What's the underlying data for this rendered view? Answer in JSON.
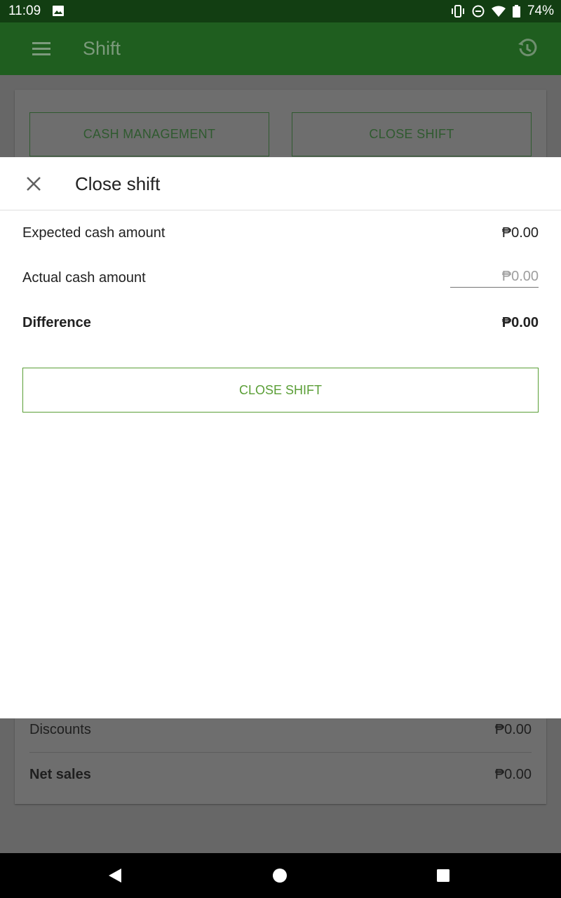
{
  "status_bar": {
    "time": "11:09",
    "battery": "74%",
    "icons": [
      "image-icon",
      "vibrate-icon",
      "do-not-disturb-icon",
      "wifi-icon",
      "battery-icon"
    ]
  },
  "app_bar": {
    "title": "Shift",
    "menu_icon": "menu-icon",
    "history_icon": "history-icon",
    "color": "#2e7d32"
  },
  "background": {
    "cash_management_label": "CASH MANAGEMENT",
    "close_shift_label": "CLOSE SHIFT",
    "rows": [
      {
        "label": "Discounts",
        "value": "₱0.00"
      },
      {
        "label": "Net sales",
        "value": "₱0.00"
      }
    ]
  },
  "dialog": {
    "title": "Close shift",
    "close_icon": "close-icon",
    "expected_label": "Expected cash amount",
    "expected_value": "₱0.00",
    "actual_label": "Actual cash amount",
    "actual_placeholder": "₱0.00",
    "difference_label": "Difference",
    "difference_value": "₱0.00",
    "button_label": "CLOSE SHIFT",
    "accent_color": "#5a9e36"
  },
  "nav_bar": {
    "icons": [
      "back-icon",
      "home-icon",
      "recents-icon"
    ]
  }
}
